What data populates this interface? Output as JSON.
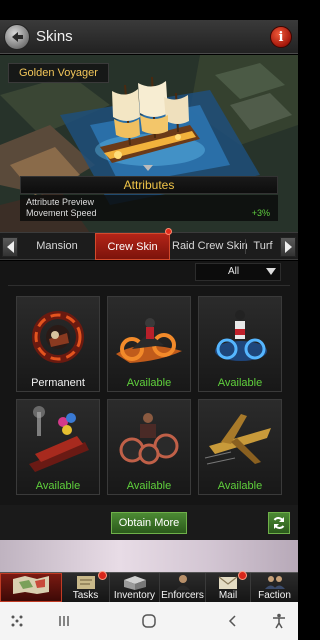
{
  "header": {
    "title": "Skins",
    "info_glyph": "i"
  },
  "preview": {
    "skin_name": "Golden Voyager",
    "attributes_title": "Attributes",
    "attribute_preview_label": "Attribute Preview",
    "attribute_stat": "Movement Speed",
    "attribute_value": "+3%"
  },
  "tabs": {
    "items": [
      {
        "label": "Mansion"
      },
      {
        "label": "Crew Skin",
        "active": true
      },
      {
        "label": "Raid Crew Skin"
      },
      {
        "label": "Turf"
      }
    ]
  },
  "filter": {
    "selected": "All"
  },
  "cards": [
    {
      "status": "Permanent",
      "icon": "fire-ring-icon"
    },
    {
      "status": "Available",
      "icon": "flame-motorbike-icon"
    },
    {
      "status": "Available",
      "icon": "blue-flame-rider-icon"
    },
    {
      "status": "Available",
      "icon": "parade-train-icon"
    },
    {
      "status": "Available",
      "icon": "tank-bike-icon"
    },
    {
      "status": "Available",
      "icon": "golden-jet-ship-icon"
    }
  ],
  "actions": {
    "obtain_more": "Obtain More"
  },
  "nav": {
    "items": [
      {
        "label": "",
        "icon": "map-icon",
        "active": true
      },
      {
        "label": "Tasks",
        "icon": "tasks-icon"
      },
      {
        "label": "Inventory",
        "icon": "inventory-icon"
      },
      {
        "label": "Enforcers",
        "icon": "enforcers-icon"
      },
      {
        "label": "Mail",
        "icon": "mail-icon"
      },
      {
        "label": "Faction",
        "icon": "faction-icon"
      }
    ]
  },
  "colors": {
    "accent_red": "#b32418",
    "available_green": "#5fd03c",
    "gold_text": "#f0c548"
  }
}
